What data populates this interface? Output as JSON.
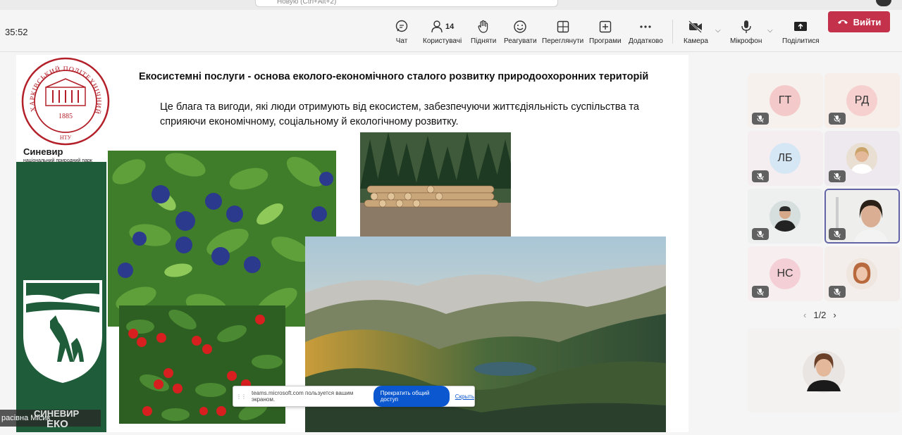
{
  "window": {
    "search_text": "Новую (Ctrl+Alt+2)",
    "timer": "35:52"
  },
  "toolbar": {
    "chat": "Чат",
    "people": "Користувачі",
    "people_count": "14",
    "raise": "Підняти",
    "react": "Реагувати",
    "view": "Переглянути",
    "apps": "Програми",
    "more": "Додатково",
    "camera": "Камера",
    "mic": "Мікрофон",
    "share": "Поділитися",
    "leave": "Вийти"
  },
  "slide": {
    "logo_year": "1885",
    "logo_text": "ХАРКІВСЬКИЙ ПОЛІТЕХНІЧНИЙ ІНСТИТУТ",
    "logo_bottom": "НТУ",
    "park_name": "Синевир",
    "park_sub": "національний природний парк",
    "title": "Екосистемні послуги  - основа еколого-економічного сталого розвитку природоохоронних територій",
    "body": "Це блага та вигоди, які люди отримують від екосистем, забезпечуючи життєдіяльність суспільства та сприяючи економічному, соціальному й екологічному розвитку."
  },
  "share_banner": {
    "message": "teams.microsoft.com пользуется вашим экраном.",
    "stop": "Прекратить общий доступ",
    "hide": "Скрыть"
  },
  "presenter": {
    "name": "расівна Місик",
    "overlay_logo": "СИНЕВИР",
    "overlay_eko": "ЕКО"
  },
  "participants": [
    {
      "initials": "ГТ",
      "color": "#f3c9c9"
    },
    {
      "initials": "РД",
      "color": "#f5d0cf"
    },
    {
      "initials": "ЛБ",
      "color": "#d5e6f5"
    },
    {
      "initials": "",
      "color": "#e8d8c8"
    },
    {
      "initials": "",
      "color": "#ddd"
    },
    {
      "initials": "",
      "color": "#eee"
    },
    {
      "initials": "НС",
      "color": "#f4d0d6"
    },
    {
      "initials": "",
      "color": "#e8c8b8"
    }
  ],
  "pager": {
    "label": "1/2"
  }
}
